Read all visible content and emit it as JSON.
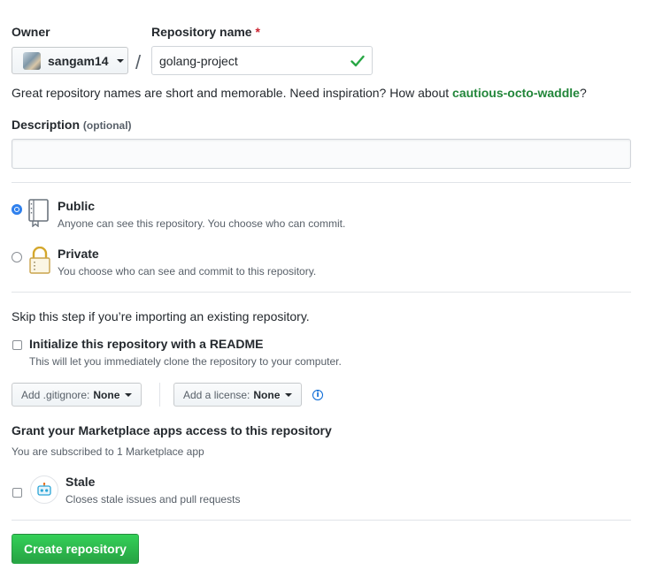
{
  "owner": {
    "label": "Owner",
    "value": "sangam14"
  },
  "separator": "/",
  "repo_name": {
    "label": "Repository name",
    "required_mark": "*",
    "value": "golang-project",
    "valid": true
  },
  "hint": {
    "text": "Great repository names are short and memorable. Need inspiration? How about ",
    "suggestion": "cautious-octo-waddle",
    "end": "?"
  },
  "description": {
    "label": "Description",
    "optional": "(optional)",
    "value": ""
  },
  "visibility": {
    "public": {
      "title": "Public",
      "sub": "Anyone can see this repository. You choose who can commit.",
      "checked": true
    },
    "private": {
      "title": "Private",
      "sub": "You choose who can see and commit to this repository.",
      "checked": false
    }
  },
  "import_note": "Skip this step if you’re importing an existing repository.",
  "readme": {
    "title": "Initialize this repository with a README",
    "sub": "This will let you immediately clone the repository to your computer.",
    "checked": false
  },
  "gitignore": {
    "label": "Add .gitignore:",
    "value": "None"
  },
  "license": {
    "label": "Add a license:",
    "value": "None"
  },
  "marketplace": {
    "title": "Grant your Marketplace apps access to this repository",
    "sub": "You are subscribed to 1 Marketplace app",
    "app": {
      "name": "Stale",
      "description": "Closes stale issues and pull requests",
      "checked": false
    }
  },
  "create_button": "Create repository",
  "colors": {
    "accent_green": "#28a745",
    "suggestion_green": "#22863a",
    "required_red": "#cb2431",
    "radio_blue": "#2f80ed",
    "info_blue": "#0366d6"
  }
}
